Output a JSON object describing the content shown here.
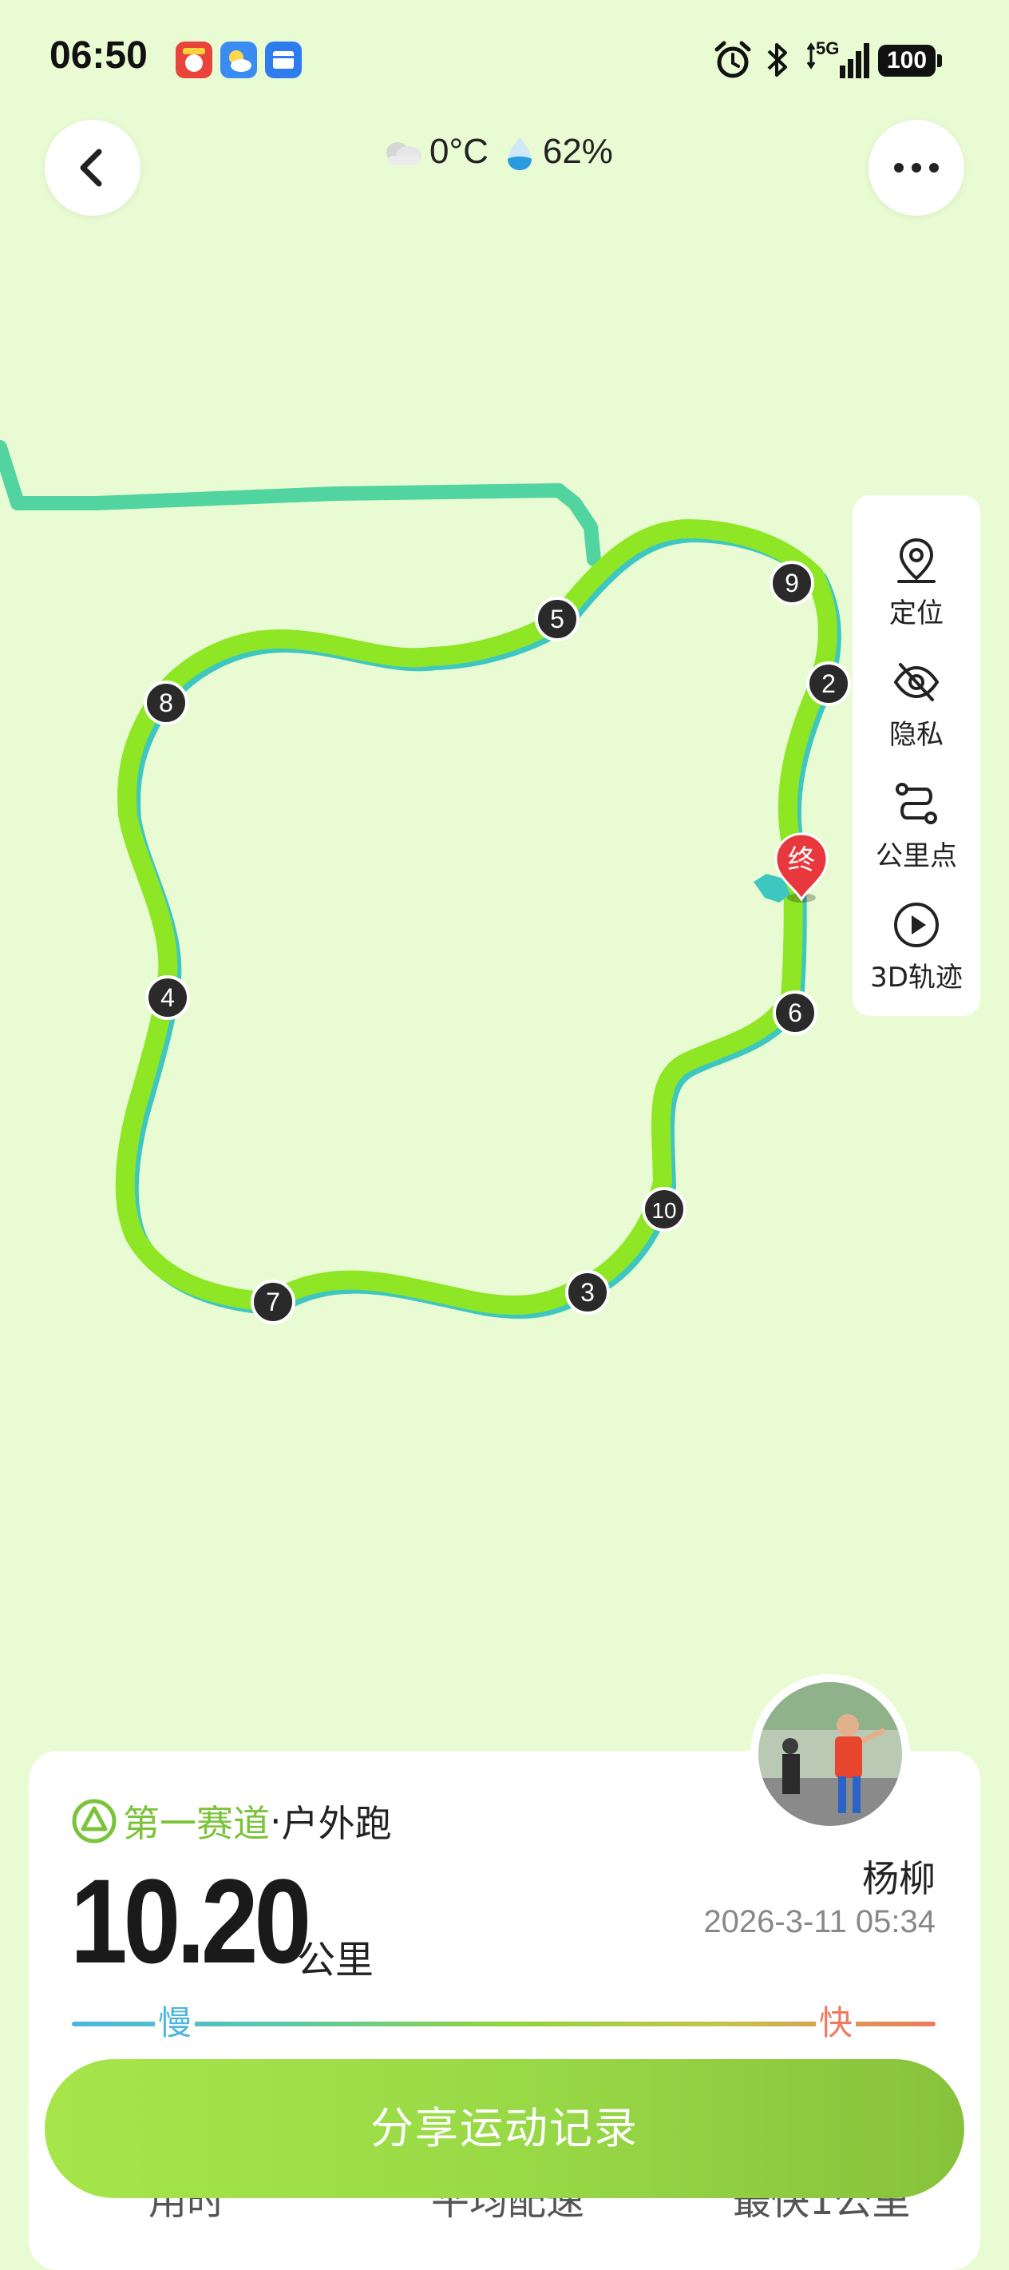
{
  "status_bar": {
    "time": "06:50",
    "network": "5G",
    "battery": "100"
  },
  "header": {
    "temperature": "0°C",
    "humidity": "62%",
    "back_icon": "chevron-left-icon",
    "more_icon": "more-dots-icon"
  },
  "map": {
    "km_markers": [
      "5",
      "9",
      "2",
      "8",
      "4",
      "6",
      "10",
      "3",
      "7"
    ],
    "end_marker": "终"
  },
  "side_panel": {
    "items": [
      {
        "label": "定位",
        "icon": "location-pin-icon"
      },
      {
        "label": "隐私",
        "icon": "eye-off-icon"
      },
      {
        "label": "公里点",
        "icon": "route-points-icon"
      },
      {
        "label": "3D轨迹",
        "icon": "play-circle-icon"
      }
    ]
  },
  "card": {
    "brand": "第一赛道",
    "separator": " · ",
    "activity_type": "户外跑",
    "distance": "10.20",
    "unit": "公里",
    "user_name": "杨柳",
    "datetime": "2026-3-11 05:34",
    "pace_slow": "慢",
    "pace_fast": "快",
    "bottom_labels": [
      "用时",
      "平均配速",
      "最快1公里"
    ]
  },
  "share_button": {
    "label": "分享运动记录"
  },
  "colors": {
    "background": "#e9fbd3",
    "track": "#8ee625",
    "track_shadow": "#3ec6c0",
    "approach_path": "#52d4a0",
    "brand_green": "#7bc33a",
    "end_marker": "#e8383d"
  }
}
